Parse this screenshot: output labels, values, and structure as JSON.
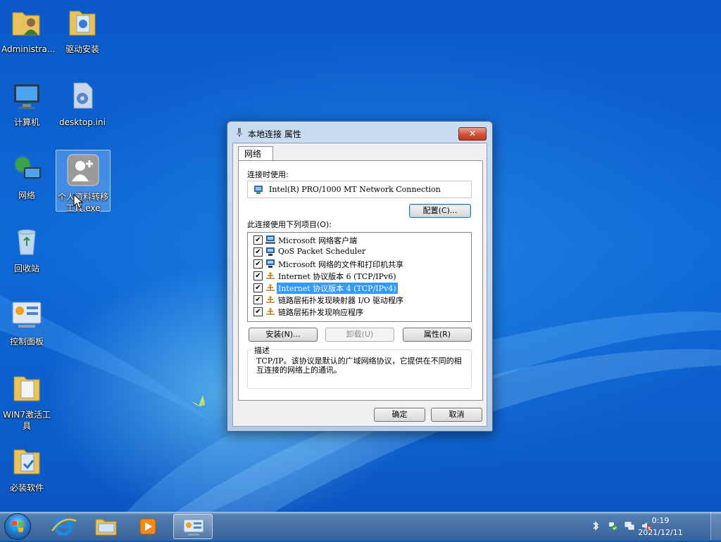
{
  "desktop": {
    "icons": [
      {
        "label": "Administra..."
      },
      {
        "label": "驱动安装"
      },
      {
        "label": "计算机"
      },
      {
        "label": "desktop.ini"
      },
      {
        "label": "网络"
      },
      {
        "label": "个人资料转移工具.exe"
      },
      {
        "label": "回收站"
      },
      {
        "label": "控制面板"
      },
      {
        "label": "WIN7激活工具"
      },
      {
        "label": "必装软件"
      }
    ]
  },
  "dialog": {
    "title": "本地连接 属性",
    "close_label": "✕",
    "tab_label": "网络",
    "connect_using_label": "连接时使用:",
    "adapter_name": "Intel(R) PRO/1000 MT Network Connection",
    "configure_label": "配置(C)...",
    "items_label": "此连接使用下列项目(O):",
    "items": [
      {
        "label": "Microsoft 网络客户端",
        "checked": true,
        "icon": "network-client-icon"
      },
      {
        "label": "QoS Packet Scheduler",
        "checked": true,
        "icon": "network-service-icon"
      },
      {
        "label": "Microsoft 网络的文件和打印机共享",
        "checked": true,
        "icon": "network-service-icon"
      },
      {
        "label": "Internet 协议版本 6 (TCP/IPv6)",
        "checked": true,
        "icon": "protocol-icon"
      },
      {
        "label": "Internet 协议版本 4 (TCP/IPv4)",
        "checked": true,
        "icon": "protocol-icon",
        "selected": true
      },
      {
        "label": "链路层拓扑发现映射器 I/O 驱动程序",
        "checked": true,
        "icon": "protocol-icon"
      },
      {
        "label": "链路层拓扑发现响应程序",
        "checked": true,
        "icon": "protocol-icon"
      }
    ],
    "check_mark": "✔",
    "install_label": "安装(N)...",
    "uninstall_label": "卸载(U)",
    "properties_label": "属性(R)",
    "description_title": "描述",
    "description_text": "TCP/IP。该协议是默认的广域网络协议，它提供在不同的相互连接的网络上的通讯。",
    "ok_label": "确定",
    "cancel_label": "取消"
  },
  "taskbar": {
    "clock_time": "0:19",
    "clock_date": "2021/12/11"
  },
  "colors": {
    "selection": "#3399ff",
    "close_button": "#c2351a",
    "desktop_background": "#0e6ad8"
  }
}
